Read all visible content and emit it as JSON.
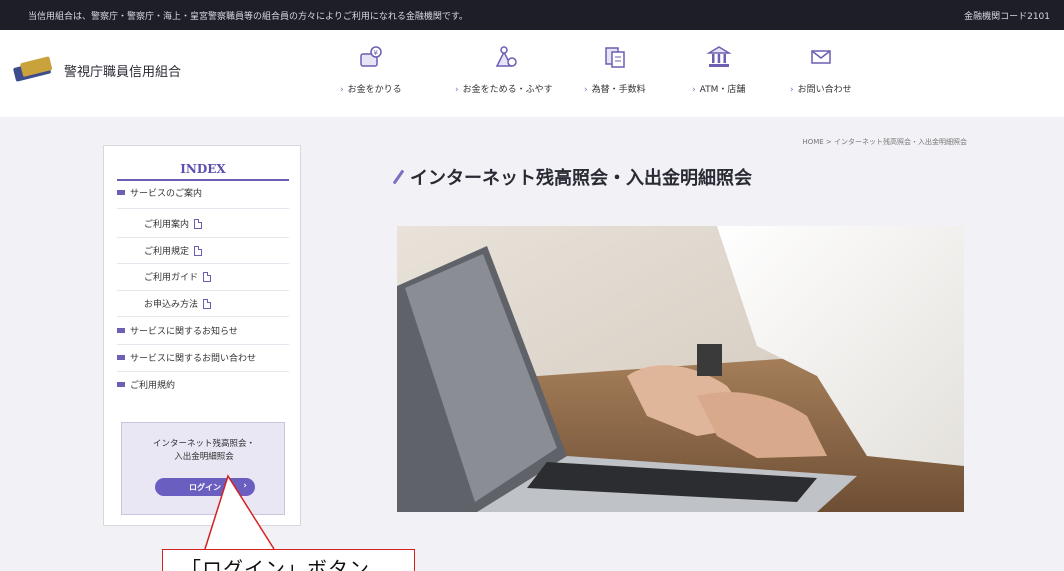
{
  "topbar": {
    "notice": "当信用組合は、警察庁・警察庁・海上・皇宮警察職員等の組合員の方々によりご利用になれる金融機関です。",
    "right_link": "金融機関コード2101"
  },
  "header": {
    "logo_text": "警視庁職員信用組合",
    "nav": [
      {
        "label": "お金をかりる",
        "icon": "money-bag-icon"
      },
      {
        "label": "お金をためる・ふやす",
        "icon": "savings-icon"
      },
      {
        "label": "為替・手数料",
        "icon": "documents-icon"
      },
      {
        "label": "ATM・店舗",
        "icon": "bank-building-icon"
      },
      {
        "label": "お問い合わせ",
        "icon": "envelope-icon"
      }
    ]
  },
  "breadcrumb": "HOME > インターネット残高照会・入出金明細照会",
  "page_title": "インターネット残高照会・入出金明細照会",
  "sidebar": {
    "index_title": "INDEX",
    "items": [
      {
        "label": "サービスのご案内"
      },
      {
        "label": "サービスに関するお知らせ"
      },
      {
        "label": "サービスに関するお問い合わせ"
      },
      {
        "label": "ご利用規約"
      }
    ],
    "sub_items": [
      {
        "label": "ご利用案内"
      },
      {
        "label": "ご利用規定"
      },
      {
        "label": "ご利用ガイド"
      },
      {
        "label": "お申込み方法"
      }
    ],
    "login_box": {
      "text_line1": "インターネット残高照会・",
      "text_line2": "入出金明細照会",
      "button_label": "ログイン"
    }
  },
  "annotation": {
    "callout_text": "「ログイン」ボタン"
  },
  "colors": {
    "accent": "#6a5fc0",
    "topbar_bg": "#1e1e28",
    "content_bg": "#f1f1f6",
    "callout_border": "#d42222"
  }
}
